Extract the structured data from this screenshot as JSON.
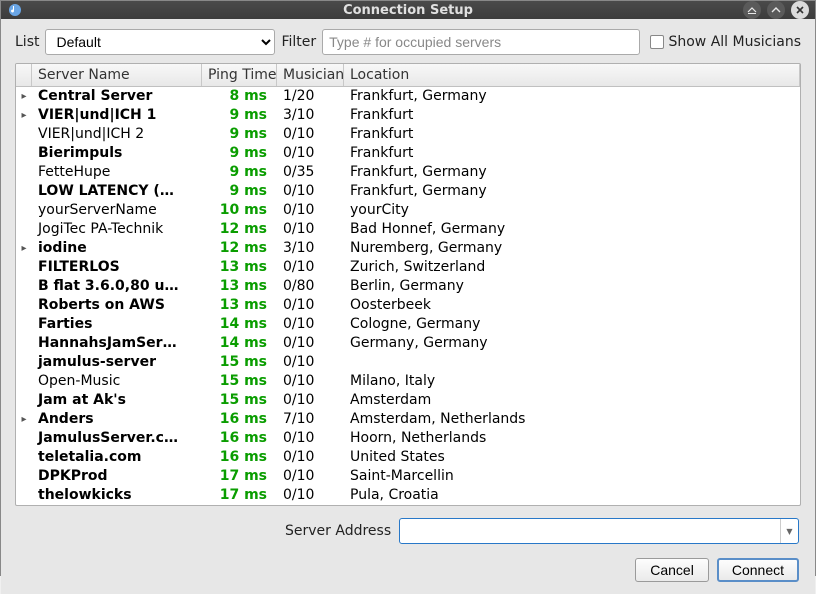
{
  "window": {
    "title": "Connection Setup",
    "app_icon": "music-note-icon"
  },
  "top": {
    "list_label": "List",
    "list_value": "Default",
    "filter_label": "Filter",
    "filter_placeholder": "Type # for occupied servers",
    "show_all_label": "Show All Musicians",
    "show_all_checked": false
  },
  "table": {
    "headers": {
      "name": "Server Name",
      "ping": "Ping Time",
      "musicians": "Musicians",
      "location": "Location"
    },
    "rows": [
      {
        "expand": true,
        "bold": true,
        "name": "Central Server",
        "ping": "8 ms",
        "mus": "1/20",
        "loc": "Frankfurt, Germany"
      },
      {
        "expand": true,
        "bold": true,
        "name": "VIER|und|ICH 1",
        "ping": "9 ms",
        "mus": "3/10",
        "loc": "Frankfurt"
      },
      {
        "expand": false,
        "bold": false,
        "name": "VIER|und|ICH 2",
        "ping": "9 ms",
        "mus": "0/10",
        "loc": "Frankfurt"
      },
      {
        "expand": false,
        "bold": true,
        "name": "Bierimpuls",
        "ping": "9 ms",
        "mus": "0/10",
        "loc": "Frankfurt"
      },
      {
        "expand": false,
        "bold": false,
        "name": "FetteHupe",
        "ping": "9 ms",
        "mus": "0/35",
        "loc": "Frankfurt, Germany"
      },
      {
        "expand": false,
        "bold": true,
        "name": "LOW LATENCY (…",
        "ping": "9 ms",
        "mus": "0/10",
        "loc": "Frankfurt, Germany"
      },
      {
        "expand": false,
        "bold": false,
        "name": "yourServerName",
        "ping": "10 ms",
        "mus": "0/10",
        "loc": "yourCity"
      },
      {
        "expand": false,
        "bold": false,
        "name": "JogiTec PA-Technik",
        "ping": "12 ms",
        "mus": "0/10",
        "loc": "Bad Honnef, Germany"
      },
      {
        "expand": true,
        "bold": true,
        "name": "iodine",
        "ping": "12 ms",
        "mus": "3/10",
        "loc": "Nuremberg, Germany"
      },
      {
        "expand": false,
        "bold": true,
        "name": "FILTERLOS",
        "ping": "13 ms",
        "mus": "0/10",
        "loc": "Zurich, Switzerland"
      },
      {
        "expand": false,
        "bold": true,
        "name": "B flat 3.6.0,80 u…",
        "ping": "13 ms",
        "mus": "0/80",
        "loc": "Berlin, Germany"
      },
      {
        "expand": false,
        "bold": true,
        "name": "Roberts on AWS",
        "ping": "13 ms",
        "mus": "0/10",
        "loc": "Oosterbeek"
      },
      {
        "expand": false,
        "bold": true,
        "name": "Farties",
        "ping": "14 ms",
        "mus": "0/10",
        "loc": "Cologne, Germany"
      },
      {
        "expand": false,
        "bold": true,
        "name": "HannahsJamSer…",
        "ping": "14 ms",
        "mus": "0/10",
        "loc": "Germany, Germany"
      },
      {
        "expand": false,
        "bold": true,
        "name": "jamulus-server",
        "ping": "15 ms",
        "mus": "0/10",
        "loc": ""
      },
      {
        "expand": false,
        "bold": false,
        "name": "Open-Music",
        "ping": "15 ms",
        "mus": "0/10",
        "loc": "Milano, Italy"
      },
      {
        "expand": false,
        "bold": true,
        "name": "Jam at Ak's",
        "ping": "15 ms",
        "mus": "0/10",
        "loc": "Amsterdam"
      },
      {
        "expand": true,
        "bold": true,
        "name": "Anders",
        "ping": "16 ms",
        "mus": "7/10",
        "loc": "Amsterdam, Netherlands"
      },
      {
        "expand": false,
        "bold": true,
        "name": "JamulusServer.c…",
        "ping": "16 ms",
        "mus": "0/10",
        "loc": "Hoorn, Netherlands"
      },
      {
        "expand": false,
        "bold": true,
        "name": "teletalia.com",
        "ping": "16 ms",
        "mus": "0/10",
        "loc": "United States"
      },
      {
        "expand": false,
        "bold": true,
        "name": "DPKProd",
        "ping": "17 ms",
        "mus": "0/10",
        "loc": "Saint-Marcellin"
      },
      {
        "expand": false,
        "bold": true,
        "name": "thelowkicks",
        "ping": "17 ms",
        "mus": "0/10",
        "loc": "Pula, Croatia"
      }
    ]
  },
  "address": {
    "label": "Server Address",
    "value": ""
  },
  "buttons": {
    "cancel": "Cancel",
    "connect": "Connect"
  }
}
